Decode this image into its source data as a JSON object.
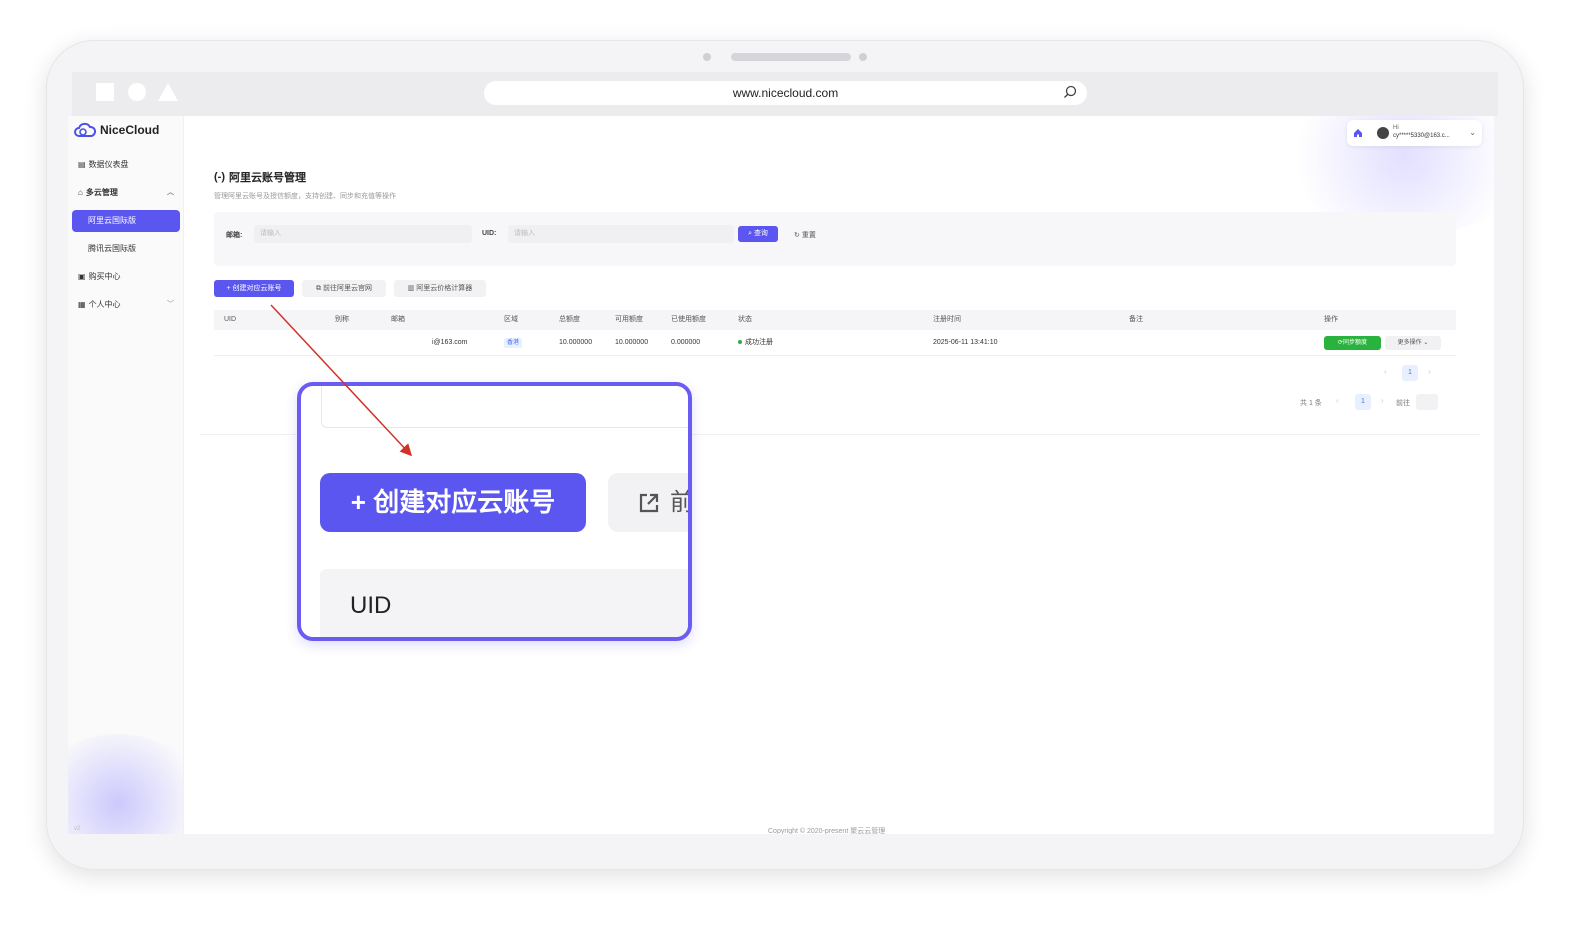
{
  "browser": {
    "url": "www.nicecloud.com"
  },
  "brand": {
    "name": "NiceCloud"
  },
  "sidebar": {
    "items": [
      {
        "label": "数据仪表盘"
      },
      {
        "label": "多云管理"
      },
      {
        "label": "阿里云国际版"
      },
      {
        "label": "腾讯云国际版"
      },
      {
        "label": "购买中心"
      },
      {
        "label": "个人中心"
      }
    ],
    "footer": "v2"
  },
  "topbar": {
    "greeting": "Hi",
    "email": "cy*****5330@163.c..."
  },
  "page": {
    "title": "阿里云账号管理",
    "subtitle": "管理阿里云账号及授信额度，支持创建、同步和充值等操作"
  },
  "filter": {
    "email_label": "邮箱:",
    "email_placeholder": "请输入",
    "uid_label": "UID:",
    "uid_placeholder": "请输入",
    "search_label": "查询",
    "reset_label": "重置"
  },
  "actions": {
    "create_label": "+ 创建对应云账号",
    "official_label": "前往阿里云官网",
    "calculator_label": "阿里云价格计算器"
  },
  "table": {
    "headers": [
      "UID",
      "别称",
      "邮箱",
      "区域",
      "总额度",
      "可用额度",
      "已使用额度",
      "状态",
      "注册时间",
      "备注",
      "操作"
    ],
    "rows": [
      {
        "uid": "",
        "alias": "",
        "email": "i@163.com",
        "region": "香港",
        "total": "10.000000",
        "available": "10.000000",
        "used": "0.000000",
        "status": "成功注册",
        "registered": "2025-06-11 13:41:10",
        "note": "",
        "sync_label": "同步额度",
        "more_label": "更多操作"
      }
    ]
  },
  "pagination": {
    "page": "1",
    "total_text": "共 1 条",
    "goto_label": "前往"
  },
  "footer": {
    "copyright": "Copyright © 2020-present 聚云云管理"
  },
  "zoom": {
    "create_label": "+ 创建对应云账号",
    "partial_label": "前",
    "uid_label": "UID"
  },
  "colors": {
    "accent": "#5b56f0",
    "success": "#2ab23f",
    "zoom_border": "#6a5cf0",
    "arrow": "#d0322a"
  }
}
